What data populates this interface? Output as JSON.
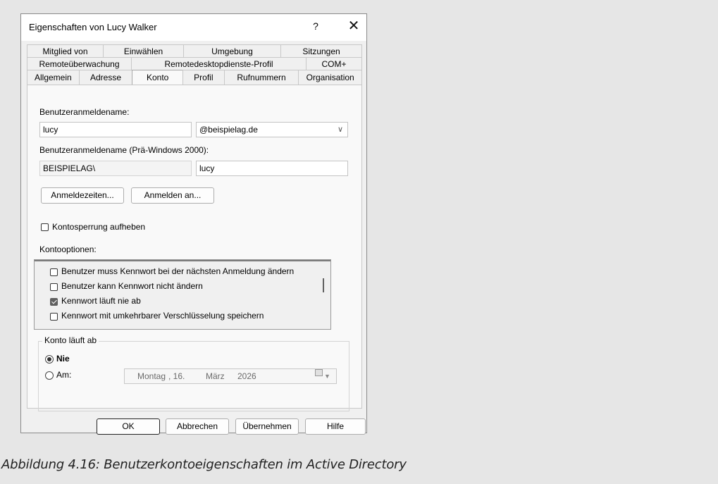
{
  "window": {
    "title": "Eigenschaften von Lucy Walker",
    "help": "?",
    "close": "✕"
  },
  "tabs": {
    "row1": [
      "Mitglied von",
      "Einwählen",
      "Umgebung",
      "Sitzungen"
    ],
    "row2": [
      "Remoteüberwachung",
      "Remotedesktopdienste-Profil",
      "COM+"
    ],
    "row3": [
      "Allgemein",
      "Adresse",
      "Konto",
      "Profil",
      "Rufnummern",
      "Organisation"
    ],
    "active": "Konto"
  },
  "account": {
    "logon_label": "Benutzeranmeldename:",
    "logon_name": "lucy",
    "domain": "@beispielag.de",
    "pre2000_label": "Benutzeranmeldename (Prä-Windows 2000):",
    "pre2000_domain": "BEISPIELAG\\",
    "pre2000_name": "lucy",
    "logon_hours_button": "Anmeldezeiten...",
    "logon_to_button": "Anmelden an...",
    "unlock_label": "Kontosperrung aufheben",
    "unlock_checked": false
  },
  "options": {
    "label": "Kontooptionen:",
    "items": [
      {
        "label": "Benutzer muss Kennwort bei der nächsten Anmeldung ändern",
        "checked": false
      },
      {
        "label": "Benutzer kann Kennwort nicht ändern",
        "checked": false
      },
      {
        "label": "Kennwort läuft nie ab",
        "checked": true
      },
      {
        "label": "Kennwort mit umkehrbarer Verschlüsselung speichern",
        "checked": false
      }
    ]
  },
  "expiry": {
    "group_label": "Konto läuft ab",
    "never_label": "Nie",
    "at_label": "Am:",
    "selected": "Nie",
    "date": {
      "weekday": "Montag",
      "day": ", 16.",
      "month": "März",
      "year": "2026"
    }
  },
  "buttons": {
    "ok": "OK",
    "cancel": "Abbrechen",
    "apply": "Übernehmen",
    "help": "Hilfe"
  },
  "caption": "Abbildung 4.16:  Benutzerkontoeigenschaften im Active Directory"
}
